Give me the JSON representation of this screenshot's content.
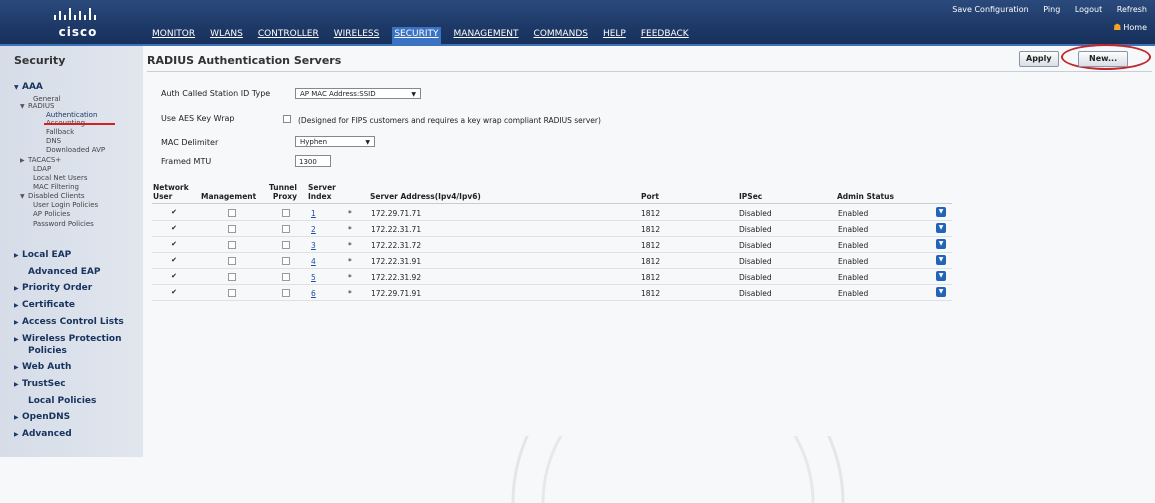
{
  "app": {
    "logo_text": "cisco"
  },
  "util_links": [
    "Save Configuration",
    "Ping",
    "Logout",
    "Refresh"
  ],
  "home_label": "Home",
  "main_nav": [
    {
      "label": "MONITOR",
      "active": false
    },
    {
      "label": "WLANs",
      "active": false
    },
    {
      "label": "CONTROLLER",
      "active": false
    },
    {
      "label": "WIRELESS",
      "active": false
    },
    {
      "label": "SECURITY",
      "active": true
    },
    {
      "label": "MANAGEMENT",
      "active": false
    },
    {
      "label": "COMMANDS",
      "active": false
    },
    {
      "label": "HELP",
      "active": false
    },
    {
      "label": "FEEDBACK",
      "active": false
    }
  ],
  "sidebar": {
    "title": "Security",
    "items": [
      {
        "label": "AAA",
        "level": 0,
        "expander": "down"
      },
      {
        "label": "General",
        "level": 1
      },
      {
        "label": "RADIUS",
        "level": 1,
        "expander": "down"
      },
      {
        "label": "Authentication",
        "level": 2,
        "active": true
      },
      {
        "label": "Accounting",
        "level": 2
      },
      {
        "label": "Fallback",
        "level": 2
      },
      {
        "label": "DNS",
        "level": 2
      },
      {
        "label": "Downloaded AVP",
        "level": 2
      },
      {
        "label": "TACACS+",
        "level": 1,
        "expander": "right"
      },
      {
        "label": "LDAP",
        "level": 1
      },
      {
        "label": "Local Net Users",
        "level": 1
      },
      {
        "label": "MAC Filtering",
        "level": 1
      },
      {
        "label": "Disabled Clients",
        "level": 1,
        "expander": "down"
      },
      {
        "label": "User Login Policies",
        "level": 1
      },
      {
        "label": "AP Policies",
        "level": 1
      },
      {
        "label": "Password Policies",
        "level": 1
      },
      {
        "label": "Local EAP",
        "level": 0,
        "expander": "right"
      },
      {
        "label": "Advanced EAP",
        "level": 0
      },
      {
        "label": "Priority Order",
        "level": 0,
        "expander": "right"
      },
      {
        "label": "Certificate",
        "level": 0,
        "expander": "right"
      },
      {
        "label": "Access Control Lists",
        "level": 0,
        "expander": "right"
      },
      {
        "label": "Wireless Protection",
        "level": 0,
        "expander": "right"
      },
      {
        "label": "Policies",
        "level": 0
      },
      {
        "label": "Web Auth",
        "level": 0,
        "expander": "right"
      },
      {
        "label": "TrustSec",
        "level": 0,
        "expander": "right"
      },
      {
        "label": "Local Policies",
        "level": 0
      },
      {
        "label": "OpenDNS",
        "level": 0,
        "expander": "right"
      },
      {
        "label": "Advanced",
        "level": 0,
        "expander": "right"
      }
    ]
  },
  "page": {
    "title": "RADIUS Authentication Servers",
    "apply_label": "Apply",
    "new_label": "New..."
  },
  "form": {
    "station_id_label": "Auth Called Station ID Type",
    "station_id_value": "AP MAC Address:SSID",
    "aes_label": "Use AES Key Wrap",
    "aes_checked": false,
    "aes_note": "(Designed for FIPS customers and requires a key wrap compliant RADIUS server)",
    "mac_delim_label": "MAC Delimiter",
    "mac_delim_value": "Hyphen",
    "mtu_label": "Framed MTU",
    "mtu_value": "1300"
  },
  "table": {
    "headers": {
      "network_user": [
        "Network",
        "User"
      ],
      "management": "Management",
      "tunnel_proxy": [
        "Tunnel",
        "Proxy"
      ],
      "server_index": [
        "Server",
        "Index"
      ],
      "server_address": "Server Address(Ipv4/Ipv6)",
      "port": "Port",
      "ipsec": "IPSec",
      "admin_status": "Admin Status"
    },
    "rows": [
      {
        "network_user": true,
        "management": false,
        "tunnel_proxy": false,
        "index": "1",
        "marker": "*",
        "address": "172.29.71.71",
        "port": "1812",
        "ipsec": "Disabled",
        "status": "Enabled"
      },
      {
        "network_user": true,
        "management": false,
        "tunnel_proxy": false,
        "index": "2",
        "marker": "*",
        "address": "172.22.31.71",
        "port": "1812",
        "ipsec": "Disabled",
        "status": "Enabled"
      },
      {
        "network_user": true,
        "management": false,
        "tunnel_proxy": false,
        "index": "3",
        "marker": "*",
        "address": "172.22.31.72",
        "port": "1812",
        "ipsec": "Disabled",
        "status": "Enabled"
      },
      {
        "network_user": true,
        "management": false,
        "tunnel_proxy": false,
        "index": "4",
        "marker": "*",
        "address": "172.22.31.91",
        "port": "1812",
        "ipsec": "Disabled",
        "status": "Enabled"
      },
      {
        "network_user": true,
        "management": false,
        "tunnel_proxy": false,
        "index": "5",
        "marker": "*",
        "address": "172.22.31.92",
        "port": "1812",
        "ipsec": "Disabled",
        "status": "Enabled"
      },
      {
        "network_user": true,
        "management": false,
        "tunnel_proxy": false,
        "index": "6",
        "marker": "*",
        "address": "172.29.71.91",
        "port": "1812",
        "ipsec": "Disabled",
        "status": "Enabled"
      }
    ]
  },
  "colors": {
    "topbar": "#1e3a68",
    "active_nav": "#3a72c4",
    "highlight_circle": "#c0272d",
    "sidebar_bg": "#d6dde8",
    "link": "#1b4f9c"
  },
  "icons": {
    "checked": "✔",
    "row_action": "chevron-down-icon",
    "home": "home-icon"
  }
}
